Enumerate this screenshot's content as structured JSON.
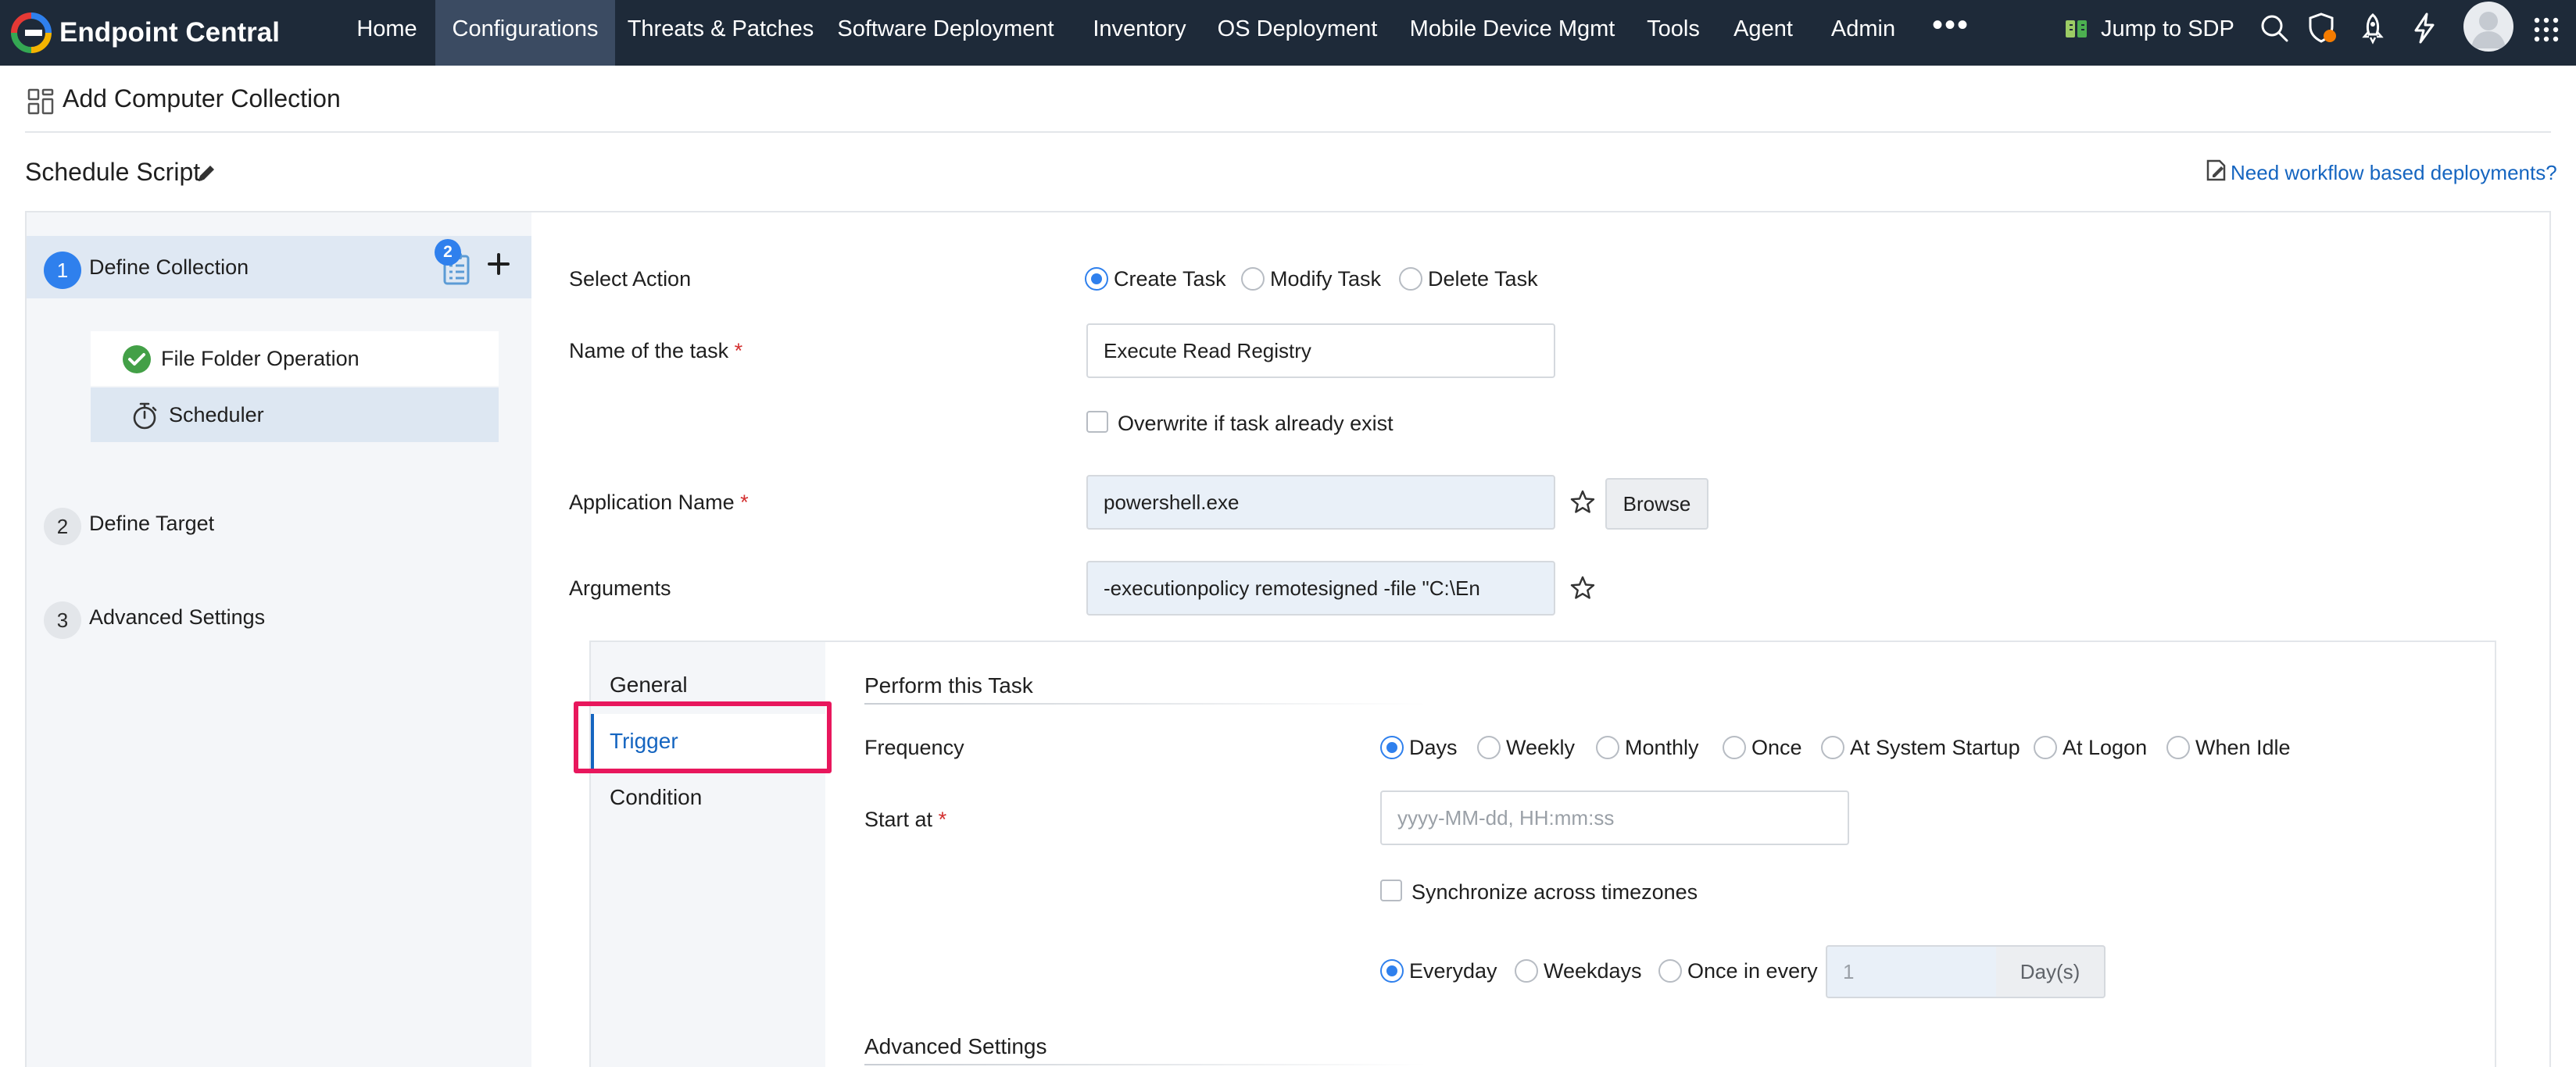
{
  "nav": {
    "brand": "Endpoint Central",
    "items": [
      {
        "label": "Home",
        "active": false
      },
      {
        "label": "Configurations",
        "active": true
      },
      {
        "label": "Threats & Patches",
        "active": false
      },
      {
        "label": "Software Deployment",
        "active": false
      },
      {
        "label": "Inventory",
        "active": false
      },
      {
        "label": "OS Deployment",
        "active": false
      },
      {
        "label": "Mobile Device Mgmt",
        "active": false
      },
      {
        "label": "Tools",
        "active": false
      },
      {
        "label": "Agent",
        "active": false
      },
      {
        "label": "Admin",
        "active": false
      }
    ],
    "more": "•••",
    "jump_label": "Jump to SDP",
    "icons": [
      "search-icon",
      "shield-icon",
      "rocket-icon",
      "bolt-icon",
      "avatar",
      "app-grid-icon"
    ]
  },
  "page": {
    "title": "Add Computer Collection",
    "schedule_title": "Schedule Script",
    "workflow_link": "Need workflow based deployments?"
  },
  "steps": [
    {
      "num": "1",
      "label": "Define Collection",
      "badge": "2"
    },
    {
      "num": "2",
      "label": "Define Target"
    },
    {
      "num": "3",
      "label": "Advanced Settings"
    }
  ],
  "sub_steps": [
    {
      "label": "File Folder Operation",
      "status": "completed"
    },
    {
      "label": "Scheduler",
      "status": "current"
    }
  ],
  "form": {
    "select_action": {
      "label": "Select Action",
      "options": [
        "Create Task",
        "Modify Task",
        "Delete Task"
      ],
      "selected": "Create Task"
    },
    "task_name": {
      "label": "Name of the task",
      "required_mark": "*",
      "value": "Execute Read Registry"
    },
    "overwrite": {
      "label": "Overwrite if task already exist",
      "checked": false
    },
    "app_name": {
      "label": "Application Name",
      "required_mark": "*",
      "value": "powershell.exe",
      "browse": "Browse"
    },
    "arguments": {
      "label": "Arguments",
      "value": "-executionpolicy remotesigned -file \"C:\\En"
    }
  },
  "scheduler": {
    "tabs": [
      "General",
      "Trigger",
      "Condition"
    ],
    "active_tab": "Trigger",
    "section_title": "Perform this Task",
    "frequency": {
      "label": "Frequency",
      "options": [
        "Days",
        "Weekly",
        "Monthly",
        "Once",
        "At System Startup",
        "At Logon",
        "When Idle"
      ],
      "selected": "Days"
    },
    "start_at": {
      "label": "Start at",
      "required_mark": "*",
      "placeholder": "yyyy-MM-dd, HH:mm:ss"
    },
    "sync_tz": {
      "label": "Synchronize across timezones",
      "checked": false
    },
    "recurrence": {
      "options": [
        "Everyday",
        "Weekdays",
        "Once in every"
      ],
      "selected": "Everyday",
      "interval_value": "1",
      "unit": "Day(s)"
    },
    "advanced_title": "Advanced Settings"
  },
  "colors": {
    "nav_bg": "#1e2a39",
    "nav_active": "#3b4b62",
    "accent": "#2f80ed",
    "link": "#1565c0",
    "highlight": "#e8175d"
  }
}
